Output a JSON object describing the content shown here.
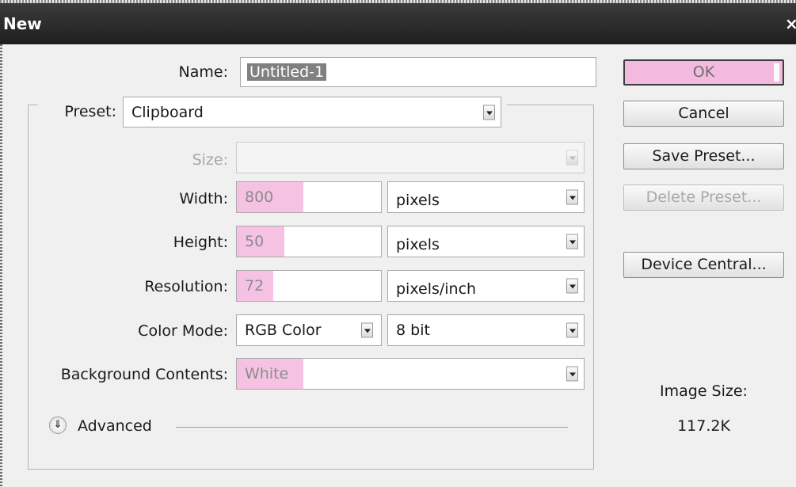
{
  "window": {
    "title": "New",
    "close_glyph": "×"
  },
  "name": {
    "label": "Name:",
    "value": "Untitled-1"
  },
  "preset": {
    "label": "Preset:",
    "value": "Clipboard"
  },
  "size": {
    "label": "Size:",
    "value": ""
  },
  "width": {
    "label": "Width:",
    "value": "800",
    "unit": "pixels"
  },
  "height": {
    "label": "Height:",
    "value": "50",
    "unit": "pixels"
  },
  "resolution": {
    "label": "Resolution:",
    "value": "72",
    "unit": "pixels/inch"
  },
  "color_mode": {
    "label": "Color Mode:",
    "value": "RGB Color",
    "depth": "8 bit"
  },
  "background": {
    "label": "Background Contents:",
    "value": "White"
  },
  "advanced": {
    "label": "Advanced",
    "icon": "double-chevron-down-icon"
  },
  "buttons": {
    "ok": "OK",
    "cancel": "Cancel",
    "save_preset": "Save Preset...",
    "delete_preset": "Delete Preset...",
    "device_central": "Device Central..."
  },
  "image_size": {
    "label": "Image Size:",
    "value": "117.2K"
  },
  "colors": {
    "highlight": "#f6c2e3",
    "ok_button": "#f4b9df",
    "titlebar": "#2a2a2a"
  }
}
